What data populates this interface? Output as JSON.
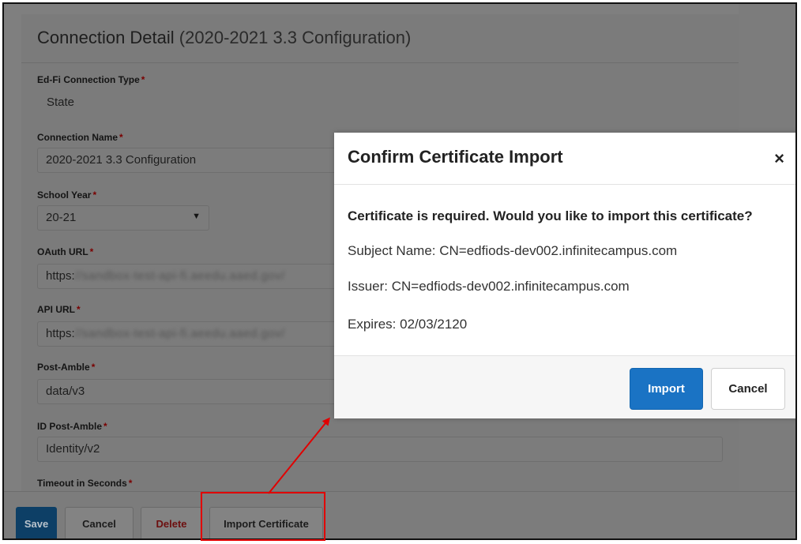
{
  "panel": {
    "title": "Connection Detail",
    "subtitle": "(2020-2021 3.3 Configuration)"
  },
  "form": {
    "connection_type": {
      "label": "Ed-Fi Connection Type",
      "value": "State"
    },
    "connection_name": {
      "label": "Connection Name",
      "value": "2020-2021 3.3 Configuration"
    },
    "school_year": {
      "label": "School Year",
      "value": "20-21"
    },
    "oauth_url": {
      "label": "OAuth URL",
      "value_prefix": "https:",
      "value_redacted": "//sandbox-test-api-fi.aeedu.aaed.gov/"
    },
    "api_url": {
      "label": "API URL",
      "value_prefix": "https:",
      "value_redacted": "//sandbox-test-api-fi.aeedu.aaed.gov/"
    },
    "post_amble": {
      "label": "Post-Amble",
      "value": "data/v3"
    },
    "id_post_amble": {
      "label": "ID Post-Amble",
      "value": "Identity/v2"
    },
    "timeout": {
      "label": "Timeout in Seconds"
    },
    "required_mark": "*"
  },
  "footer": {
    "save": "Save",
    "cancel": "Cancel",
    "delete": "Delete",
    "import_certificate": "Import Certificate"
  },
  "modal": {
    "title": "Confirm Certificate Import",
    "close_glyph": "×",
    "question": "Certificate is required. Would you like to import this certificate?",
    "subject": "Subject Name: CN=edfiods-dev002.infinitecampus.com",
    "issuer": "Issuer: CN=edfiods-dev002.infinitecampus.com",
    "expires": "Expires: 02/03/2120",
    "import_button": "Import",
    "cancel_button": "Cancel"
  },
  "colors": {
    "primary_button": "#1a73c4",
    "annotation": "#e10000",
    "required": "#a00000"
  }
}
